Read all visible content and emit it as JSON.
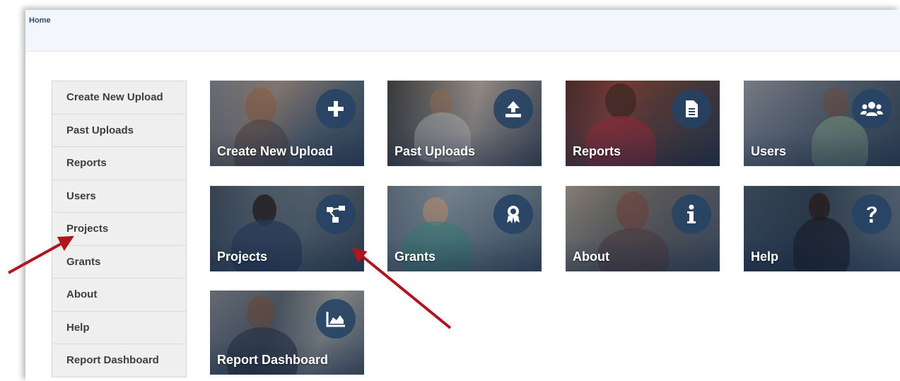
{
  "breadcrumb": {
    "home": "Home"
  },
  "sidebar": {
    "items": [
      {
        "label": "Create New Upload"
      },
      {
        "label": "Past Uploads"
      },
      {
        "label": "Reports"
      },
      {
        "label": "Users"
      },
      {
        "label": "Projects"
      },
      {
        "label": "Grants"
      },
      {
        "label": "About"
      },
      {
        "label": "Help"
      },
      {
        "label": "Report Dashboard"
      }
    ]
  },
  "tiles": [
    {
      "label": "Create New Upload",
      "icon": "plus-icon"
    },
    {
      "label": "Past Uploads",
      "icon": "upload-icon"
    },
    {
      "label": "Reports",
      "icon": "document-icon"
    },
    {
      "label": "Users",
      "icon": "users-icon"
    },
    {
      "label": "Projects",
      "icon": "project-tree-icon"
    },
    {
      "label": "Grants",
      "icon": "award-icon"
    },
    {
      "label": "About",
      "icon": "info-icon"
    },
    {
      "label": "Help",
      "icon": "question-icon"
    },
    {
      "label": "Report Dashboard",
      "icon": "area-chart-icon"
    }
  ],
  "annotation_arrow_color": "#b0141c"
}
